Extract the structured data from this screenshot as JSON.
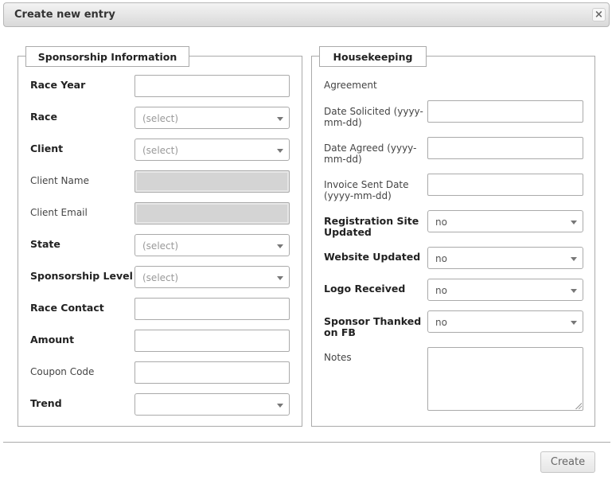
{
  "dialog": {
    "title": "Create new entry",
    "close_icon": "×",
    "create_label": "Create"
  },
  "sponsorship": {
    "legend": "Sponsorship Information",
    "race_year_label": "Race Year",
    "race_year_value": "",
    "race_label": "Race",
    "race_value": "(select)",
    "client_label": "Client",
    "client_value": "(select)",
    "client_name_label": "Client Name",
    "client_email_label": "Client Email",
    "state_label": "State",
    "state_value": "(select)",
    "level_label": "Sponsorship Level",
    "level_value": "(select)",
    "race_contact_label": "Race Contact",
    "amount_label": "Amount",
    "coupon_label": "Coupon Code",
    "trend_label": "Trend",
    "trend_value": ""
  },
  "housekeeping": {
    "legend": "Housekeeping",
    "agreement_label": "Agreement",
    "date_solicited_label_1": "Date Solicited (yyyy-",
    "date_solicited_label_2": "mm-dd)",
    "date_agreed_label_1": "Date Agreed (yyyy-",
    "date_agreed_label_2": "mm-dd)",
    "invoice_label_1": "Invoice Sent Date",
    "invoice_label_2": "(yyyy-mm-dd)",
    "reg_site_label_1": "Registration Site",
    "reg_site_label_2": "Updated",
    "reg_site_value": "no",
    "website_label": "Website Updated",
    "website_value": "no",
    "logo_label": "Logo Received",
    "logo_value": "no",
    "thanked_label_1": "Sponsor Thanked",
    "thanked_label_2": "on FB",
    "thanked_value": "no",
    "notes_label": "Notes"
  },
  "icons": {
    "close": "close-icon",
    "dropdown": "chevron-down-icon",
    "resize": "resize-handle-icon"
  }
}
